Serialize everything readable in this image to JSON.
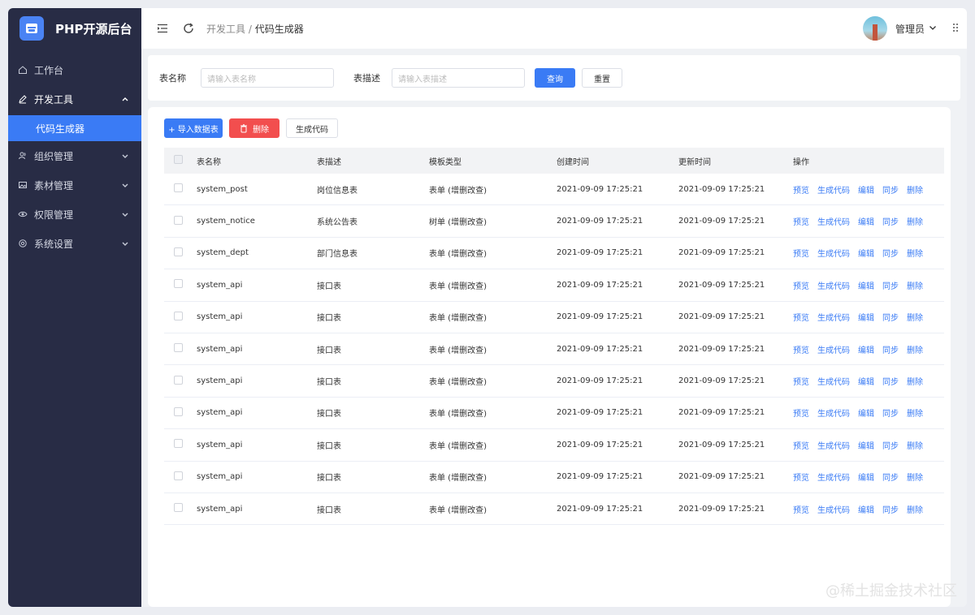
{
  "app": {
    "title": "PHP开源后台"
  },
  "sidebar": {
    "items": [
      {
        "label": "工作台",
        "icon": "home-icon",
        "expandable": false
      },
      {
        "label": "开发工具",
        "icon": "edit-icon",
        "expandable": true,
        "expanded": true,
        "children": [
          {
            "label": "代码生成器",
            "active": true
          }
        ]
      },
      {
        "label": "组织管理",
        "icon": "users-icon",
        "expandable": true
      },
      {
        "label": "素材管理",
        "icon": "image-icon",
        "expandable": true
      },
      {
        "label": "权限管理",
        "icon": "eye-icon",
        "expandable": true
      },
      {
        "label": "系统设置",
        "icon": "settings-icon",
        "expandable": true
      }
    ]
  },
  "header": {
    "breadcrumb": {
      "parent": "开发工具",
      "separator": " / ",
      "current": "代码生成器"
    },
    "user": {
      "name": "管理员"
    }
  },
  "search": {
    "name_label": "表名称",
    "name_placeholder": "请输入表名称",
    "desc_label": "表描述",
    "desc_placeholder": "请输入表描述",
    "query_button": "查询",
    "reset_button": "重置"
  },
  "toolbar": {
    "import_button": "+ 导入数据表",
    "delete_button": "删除",
    "generate_button": "生成代码"
  },
  "table": {
    "columns": [
      "表名称",
      "表描述",
      "模板类型",
      "创建时间",
      "更新时间",
      "操作"
    ],
    "actions": [
      "预览",
      "生成代码",
      "编辑",
      "同步",
      "删除"
    ],
    "rows": [
      {
        "name": "system_post",
        "desc": "岗位信息表",
        "template": "表单 (增删改查)",
        "created": "2021-09-09 17:25:21",
        "updated": "2021-09-09 17:25:21"
      },
      {
        "name": "system_notice",
        "desc": "系统公告表",
        "template": "树单 (增删改查)",
        "created": "2021-09-09 17:25:21",
        "updated": "2021-09-09 17:25:21"
      },
      {
        "name": "system_dept",
        "desc": "部门信息表",
        "template": "表单 (增删改查)",
        "created": "2021-09-09 17:25:21",
        "updated": "2021-09-09 17:25:21"
      },
      {
        "name": "system_api",
        "desc": "接口表",
        "template": "表单 (增删改查)",
        "created": "2021-09-09 17:25:21",
        "updated": "2021-09-09 17:25:21"
      },
      {
        "name": "system_api",
        "desc": "接口表",
        "template": "表单 (增删改查)",
        "created": "2021-09-09 17:25:21",
        "updated": "2021-09-09 17:25:21"
      },
      {
        "name": "system_api",
        "desc": "接口表",
        "template": "表单 (增删改查)",
        "created": "2021-09-09 17:25:21",
        "updated": "2021-09-09 17:25:21"
      },
      {
        "name": "system_api",
        "desc": "接口表",
        "template": "表单 (增删改查)",
        "created": "2021-09-09 17:25:21",
        "updated": "2021-09-09 17:25:21"
      },
      {
        "name": "system_api",
        "desc": "接口表",
        "template": "表单 (增删改查)",
        "created": "2021-09-09 17:25:21",
        "updated": "2021-09-09 17:25:21"
      },
      {
        "name": "system_api",
        "desc": "接口表",
        "template": "表单 (增删改查)",
        "created": "2021-09-09 17:25:21",
        "updated": "2021-09-09 17:25:21"
      },
      {
        "name": "system_api",
        "desc": "接口表",
        "template": "表单 (增删改查)",
        "created": "2021-09-09 17:25:21",
        "updated": "2021-09-09 17:25:21"
      },
      {
        "name": "system_api",
        "desc": "接口表",
        "template": "表单 (增删改查)",
        "created": "2021-09-09 17:25:21",
        "updated": "2021-09-09 17:25:21"
      }
    ]
  },
  "watermark": "@稀土掘金技术社区",
  "colors": {
    "sidebar_bg": "#282c45",
    "accent": "#3a7bf5",
    "danger": "#f24e4e"
  }
}
